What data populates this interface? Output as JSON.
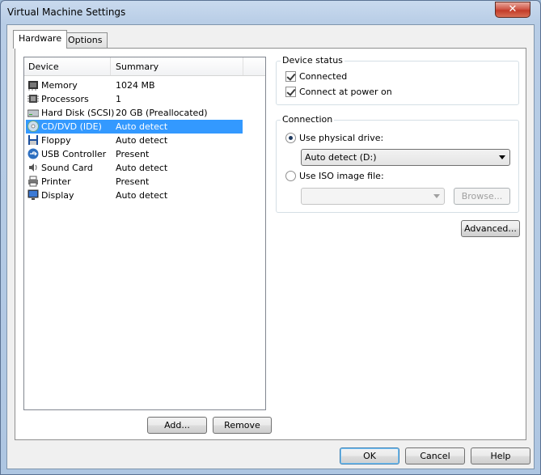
{
  "window": {
    "title": "Virtual Machine Settings"
  },
  "tabs": [
    {
      "label": "Hardware",
      "active": true
    },
    {
      "label": "Options",
      "active": false
    }
  ],
  "device_list": {
    "columns": [
      "Device",
      "Summary"
    ],
    "rows": [
      {
        "name": "Memory",
        "summary": "1024 MB",
        "icon": "memory-icon",
        "selected": false
      },
      {
        "name": "Processors",
        "summary": "1",
        "icon": "processor-icon",
        "selected": false
      },
      {
        "name": "Hard Disk (SCSI)",
        "summary": "20 GB (Preallocated)",
        "icon": "hard-disk-icon",
        "selected": false
      },
      {
        "name": "CD/DVD (IDE)",
        "summary": "Auto detect",
        "icon": "cd-dvd-icon",
        "selected": true
      },
      {
        "name": "Floppy",
        "summary": "Auto detect",
        "icon": "floppy-icon",
        "selected": false
      },
      {
        "name": "USB Controller",
        "summary": "Present",
        "icon": "usb-icon",
        "selected": false
      },
      {
        "name": "Sound Card",
        "summary": "Auto detect",
        "icon": "sound-card-icon",
        "selected": false
      },
      {
        "name": "Printer",
        "summary": "Present",
        "icon": "printer-icon",
        "selected": false
      },
      {
        "name": "Display",
        "summary": "Auto detect",
        "icon": "display-icon",
        "selected": false
      }
    ]
  },
  "list_buttons": {
    "add": "Add...",
    "remove": "Remove"
  },
  "device_status": {
    "title": "Device status",
    "connected": {
      "label": "Connected",
      "checked": true
    },
    "connect_at_power_on": {
      "label": "Connect at power on",
      "checked": true
    }
  },
  "connection": {
    "title": "Connection",
    "physical": {
      "label": "Use physical drive:",
      "selected": true,
      "value": "Auto detect (D:)"
    },
    "iso": {
      "label": "Use ISO image file:",
      "selected": false,
      "value": "",
      "browse": "Browse..."
    }
  },
  "advanced_button": "Advanced...",
  "footer": {
    "ok": "OK",
    "cancel": "Cancel",
    "help": "Help"
  },
  "colors": {
    "selection": "#3399ff",
    "close": "#c23b28"
  }
}
